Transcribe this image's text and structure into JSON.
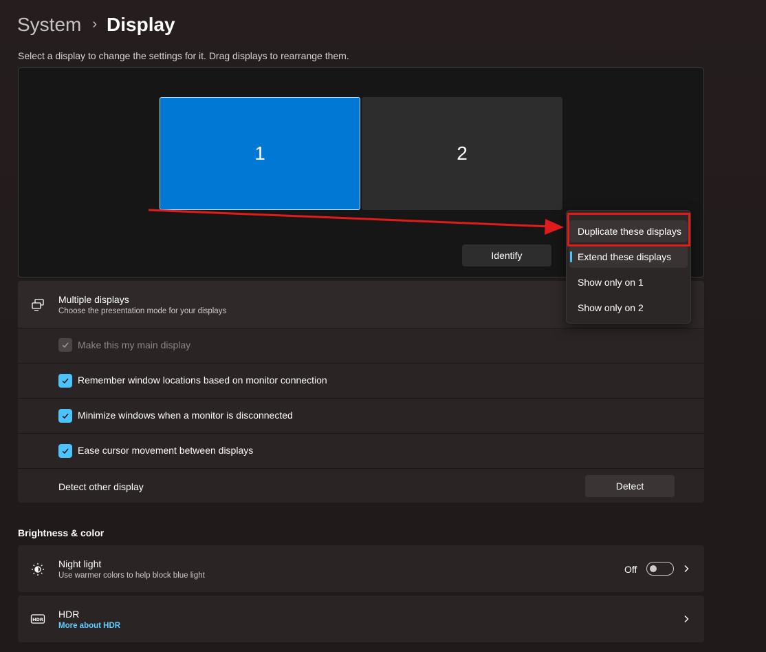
{
  "breadcrumb": {
    "parent": "System",
    "separator": "›",
    "current": "Display"
  },
  "instructions": "Select a display to change the settings for it. Drag displays to rearrange them.",
  "arrangement": {
    "monitors": [
      {
        "label": "1",
        "selected": true,
        "color": "#0078d4"
      },
      {
        "label": "2",
        "selected": false,
        "color": "#2d2d2d"
      }
    ],
    "identify_label": "Identify"
  },
  "multiple_displays": {
    "icon": "multiple-displays-icon",
    "title": "Multiple displays",
    "subtitle": "Choose the presentation mode for your displays",
    "options": [
      {
        "label": "Make this my main display",
        "checked": true,
        "disabled": true
      },
      {
        "label": "Remember window locations based on monitor connection",
        "checked": true,
        "disabled": false
      },
      {
        "label": "Minimize windows when a monitor is disconnected",
        "checked": true,
        "disabled": false
      },
      {
        "label": "Ease cursor movement between displays",
        "checked": true,
        "disabled": false
      }
    ],
    "detect_label": "Detect other display",
    "detect_button": "Detect"
  },
  "dropdown": {
    "items": [
      {
        "label": "Duplicate these displays",
        "hovered": true,
        "selected": false
      },
      {
        "label": "Extend these displays",
        "hovered": false,
        "selected": true
      },
      {
        "label": "Show only on 1",
        "hovered": false,
        "selected": false
      },
      {
        "label": "Show only on 2",
        "hovered": false,
        "selected": false
      }
    ]
  },
  "brightness_section": {
    "heading": "Brightness & color",
    "night_light": {
      "icon": "night-light-icon",
      "title": "Night light",
      "subtitle": "Use warmer colors to help block blue light",
      "state_label": "Off",
      "on": false
    },
    "hdr": {
      "icon": "hdr-icon",
      "title": "HDR",
      "link": "More about HDR"
    }
  },
  "colors": {
    "accent": "#4cc2ff",
    "monitor_selected": "#0078d4",
    "annotation": "#e01b1b"
  }
}
